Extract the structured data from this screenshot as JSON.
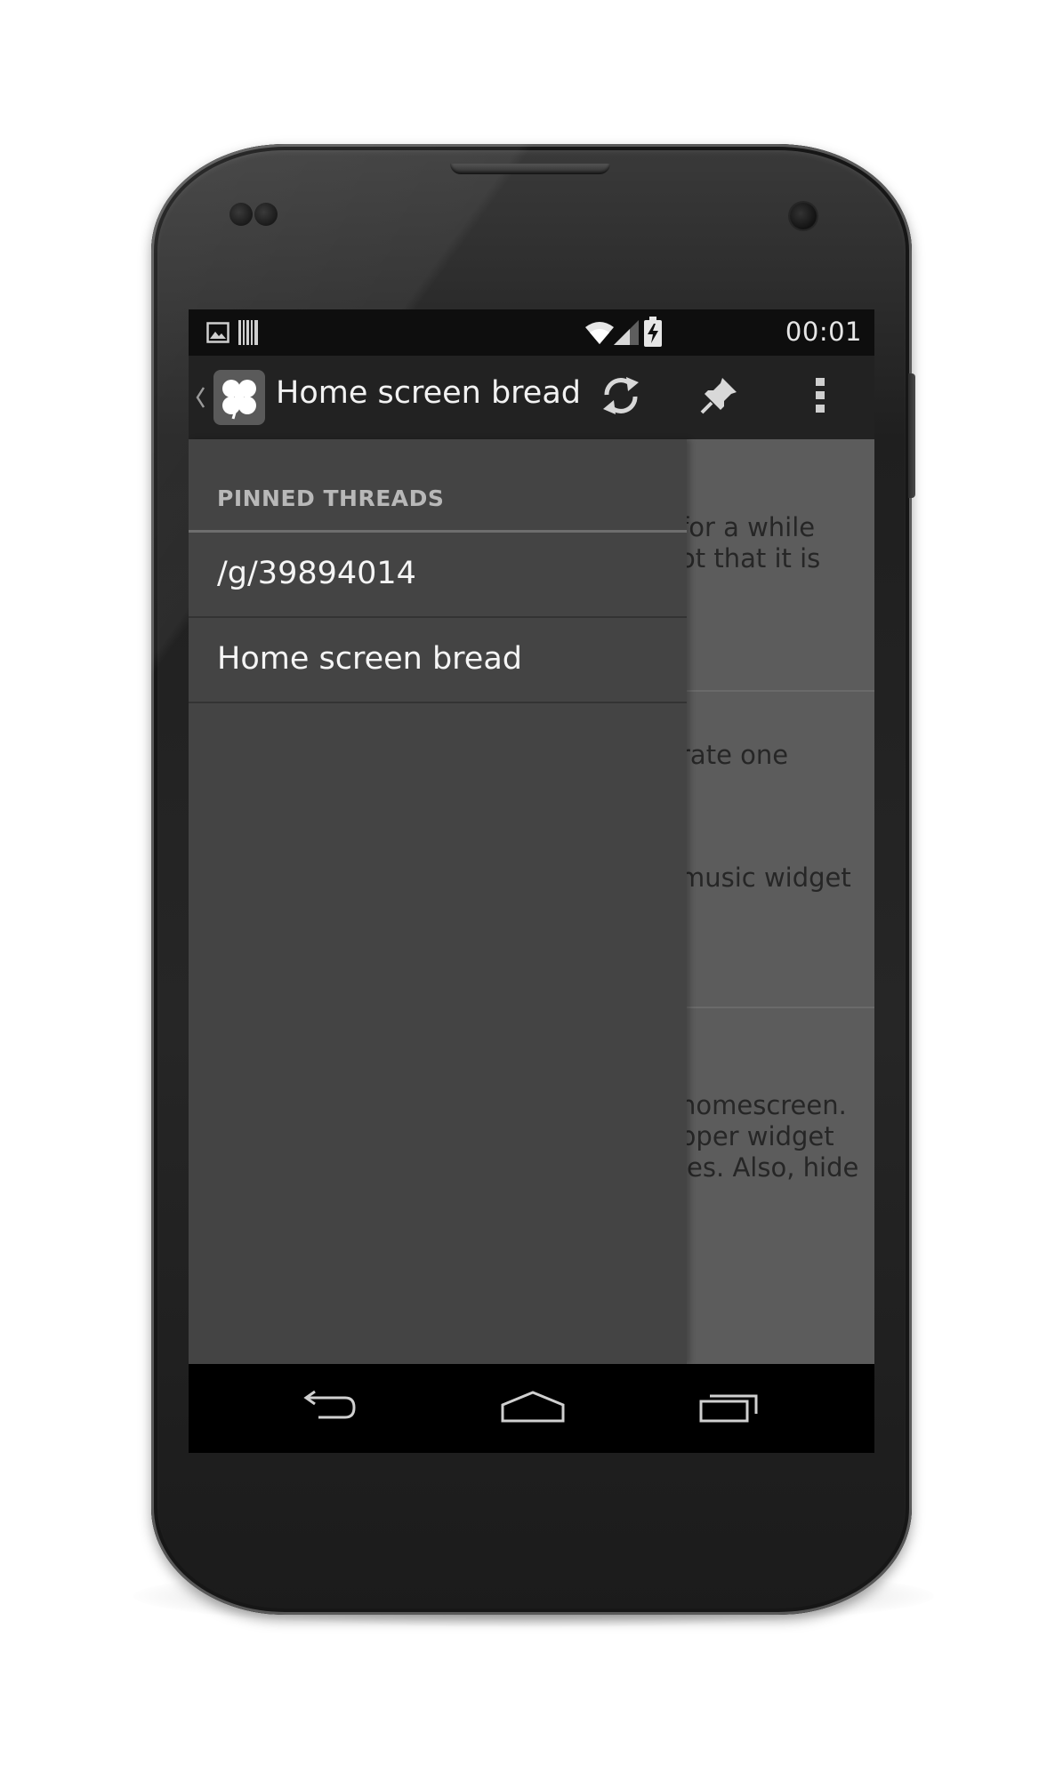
{
  "status_bar": {
    "time": "00:01",
    "notification_icons": [
      "gallery-icon",
      "barcode-icon"
    ],
    "system_icons": [
      "wifi-icon",
      "signal-icon",
      "battery-charging-icon"
    ]
  },
  "action_bar": {
    "title": "Home screen bread",
    "up_icon": "chevron-left-icon",
    "app_icon": "clover-icon",
    "actions": [
      "refresh-icon",
      "pin-icon",
      "overflow-menu-icon"
    ]
  },
  "drawer": {
    "header": "PINNED THREADS",
    "items": [
      {
        "label": "/g/39894014"
      },
      {
        "label": "Home screen bread"
      }
    ]
  },
  "content": {
    "cards": [
      {
        "lines": [
          "for a while",
          "ot that it is"
        ]
      },
      {
        "lines": [
          "rate one"
        ]
      },
      {
        "lines": [
          "music widget"
        ]
      },
      {
        "lines": [
          "homescreen.",
          "pper widget",
          "ies. Also, hide"
        ]
      }
    ]
  },
  "nav_bar": {
    "buttons": [
      "back-icon",
      "home-icon",
      "recents-icon"
    ]
  },
  "colors": {
    "status_bar": "#0e0e0e",
    "action_bar": "#222222",
    "drawer": "#444444",
    "content_dimmed": "#5c5c5c",
    "nav_bar": "#000000"
  }
}
